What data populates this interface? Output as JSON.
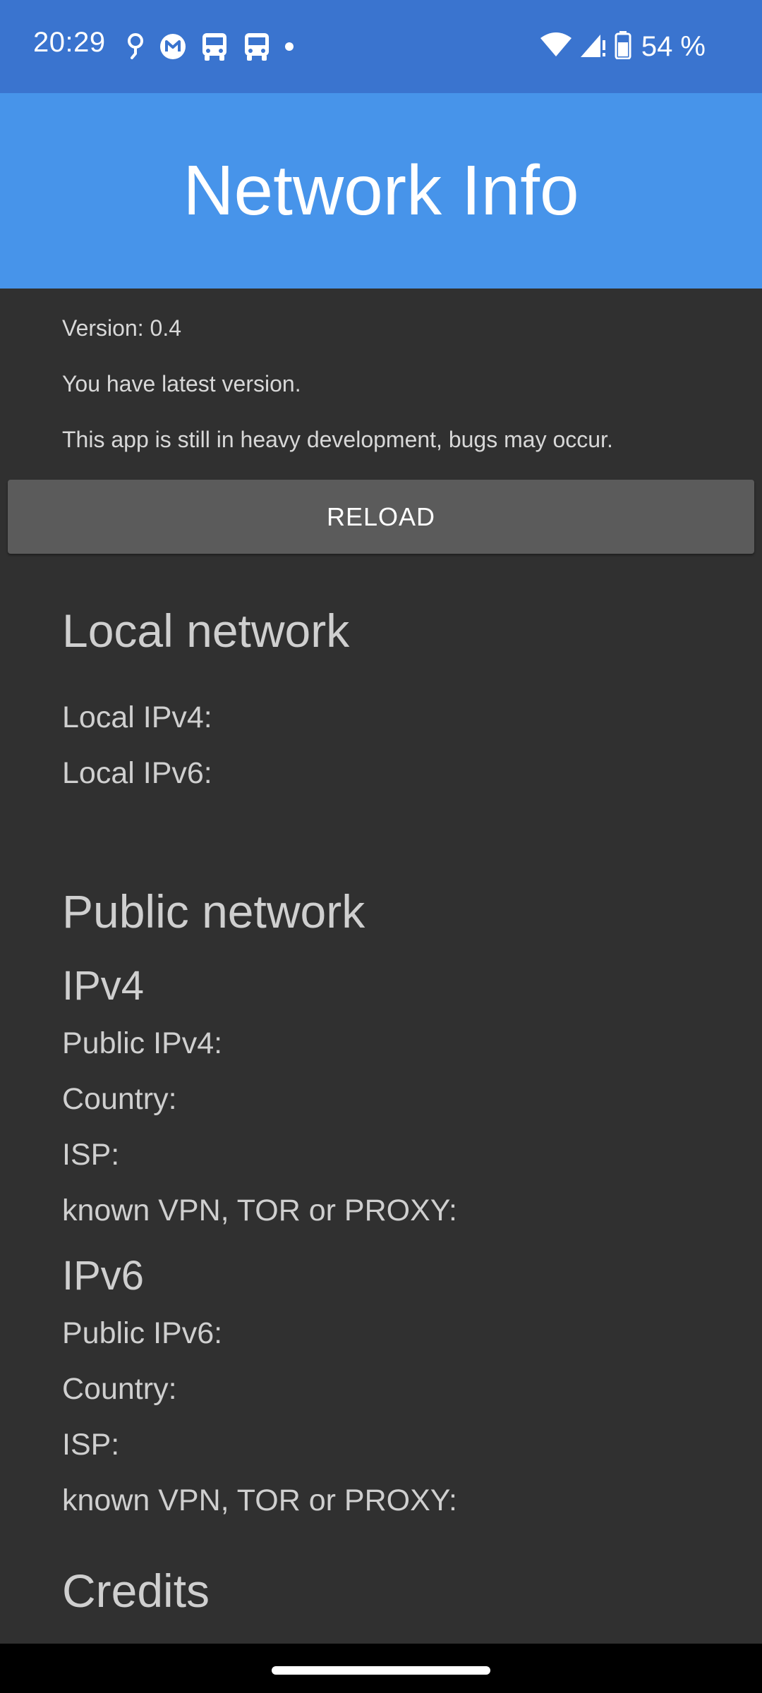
{
  "status_bar": {
    "time": "20:29",
    "battery": "54 %",
    "left_icons": [
      "location-pin-icon",
      "gmail-icon",
      "bus-icon",
      "bus-icon",
      "dot-icon"
    ],
    "right_icons": [
      "wifi-icon",
      "cell-signal-icon",
      "battery-icon"
    ]
  },
  "header": {
    "title": "Network Info"
  },
  "info": {
    "version": "Version: 0.4",
    "update_status": "You have latest version.",
    "notice": "This app is still in heavy development, bugs may occur."
  },
  "reload_button": {
    "label": "RELOAD"
  },
  "local_network": {
    "heading": "Local network",
    "ipv4_label": "Local IPv4:",
    "ipv6_label": "Local IPv6:"
  },
  "public_network": {
    "heading": "Public network",
    "ipv4": {
      "heading": "IPv4",
      "ip_label": "Public IPv4:",
      "country_label": "Country:",
      "isp_label": "ISP:",
      "vpn_label": "known VPN, TOR or PROXY:"
    },
    "ipv6": {
      "heading": "IPv6",
      "ip_label": "Public IPv6:",
      "country_label": "Country:",
      "isp_label": "ISP:",
      "vpn_label": "known VPN, TOR or PROXY:"
    }
  },
  "credits": {
    "heading": "Credits"
  },
  "colors": {
    "status_bar": "#3a74cf",
    "header": "#4794ea",
    "background": "#303030",
    "button": "#5b5b5b",
    "text": "#cfcfcf"
  }
}
